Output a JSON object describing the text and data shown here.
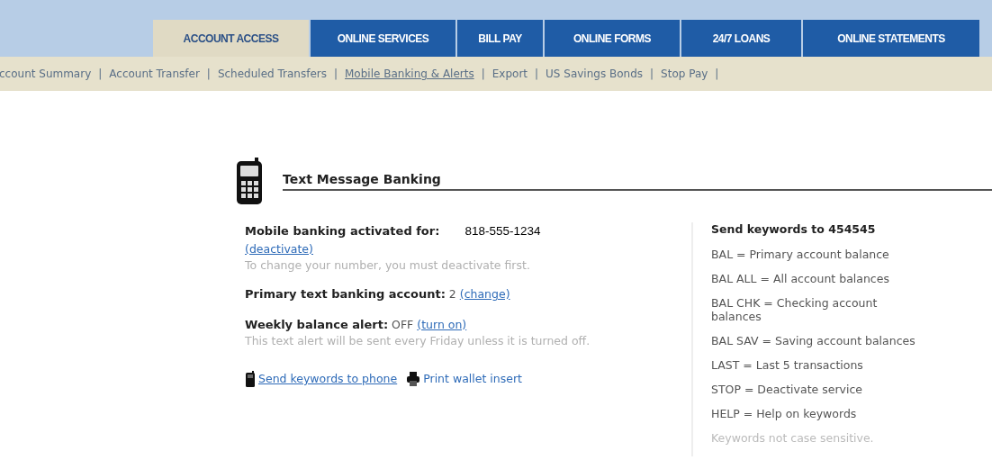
{
  "tabs": [
    {
      "label": "ACCOUNT ACCESS",
      "selected": true
    },
    {
      "label": "ONLINE SERVICES",
      "selected": false
    },
    {
      "label": "BILL PAY",
      "selected": false
    },
    {
      "label": "ONLINE FORMS",
      "selected": false
    },
    {
      "label": "24/7 LOANS",
      "selected": false
    },
    {
      "label": "ONLINE STATEMENTS",
      "selected": false
    }
  ],
  "subnav": [
    {
      "label": "ccount Summary",
      "selected": false
    },
    {
      "label": "Account Transfer",
      "selected": false
    },
    {
      "label": "Scheduled Transfers",
      "selected": false
    },
    {
      "label": "Mobile Banking & Alerts",
      "selected": true
    },
    {
      "label": "Export",
      "selected": false
    },
    {
      "label": "US Savings Bonds",
      "selected": false
    },
    {
      "label": "Stop Pay",
      "selected": false
    }
  ],
  "subnav_separator": "|",
  "section": {
    "title": "Text Message Banking",
    "activation": {
      "label": "Mobile banking activated for:",
      "phone": "818-555-1234",
      "link": "(deactivate)",
      "hint": "To change your number, you must deactivate first."
    },
    "primary_account": {
      "label": "Primary text banking account:",
      "value": "2",
      "link": "(change)"
    },
    "weekly_alert": {
      "label": "Weekly balance alert:",
      "value": "OFF",
      "link": "(turn on)",
      "hint": "This text alert will be sent every Friday unless it is turned off."
    },
    "actions": [
      {
        "label": "Send keywords to phone",
        "kind": "phone",
        "underlined": true
      },
      {
        "label": "Print wallet insert",
        "kind": "print",
        "underlined": false
      }
    ],
    "keywords": {
      "title": "Send keywords to 454545",
      "items": [
        "BAL = Primary account balance",
        "BAL ALL = All account balances",
        "BAL CHK = Checking account balances",
        "BAL SAV = Saving account balances",
        "LAST = Last 5 transactions",
        "STOP = Deactivate service",
        "HELP = Help on keywords"
      ],
      "note": "Keywords not case sensitive."
    }
  }
}
